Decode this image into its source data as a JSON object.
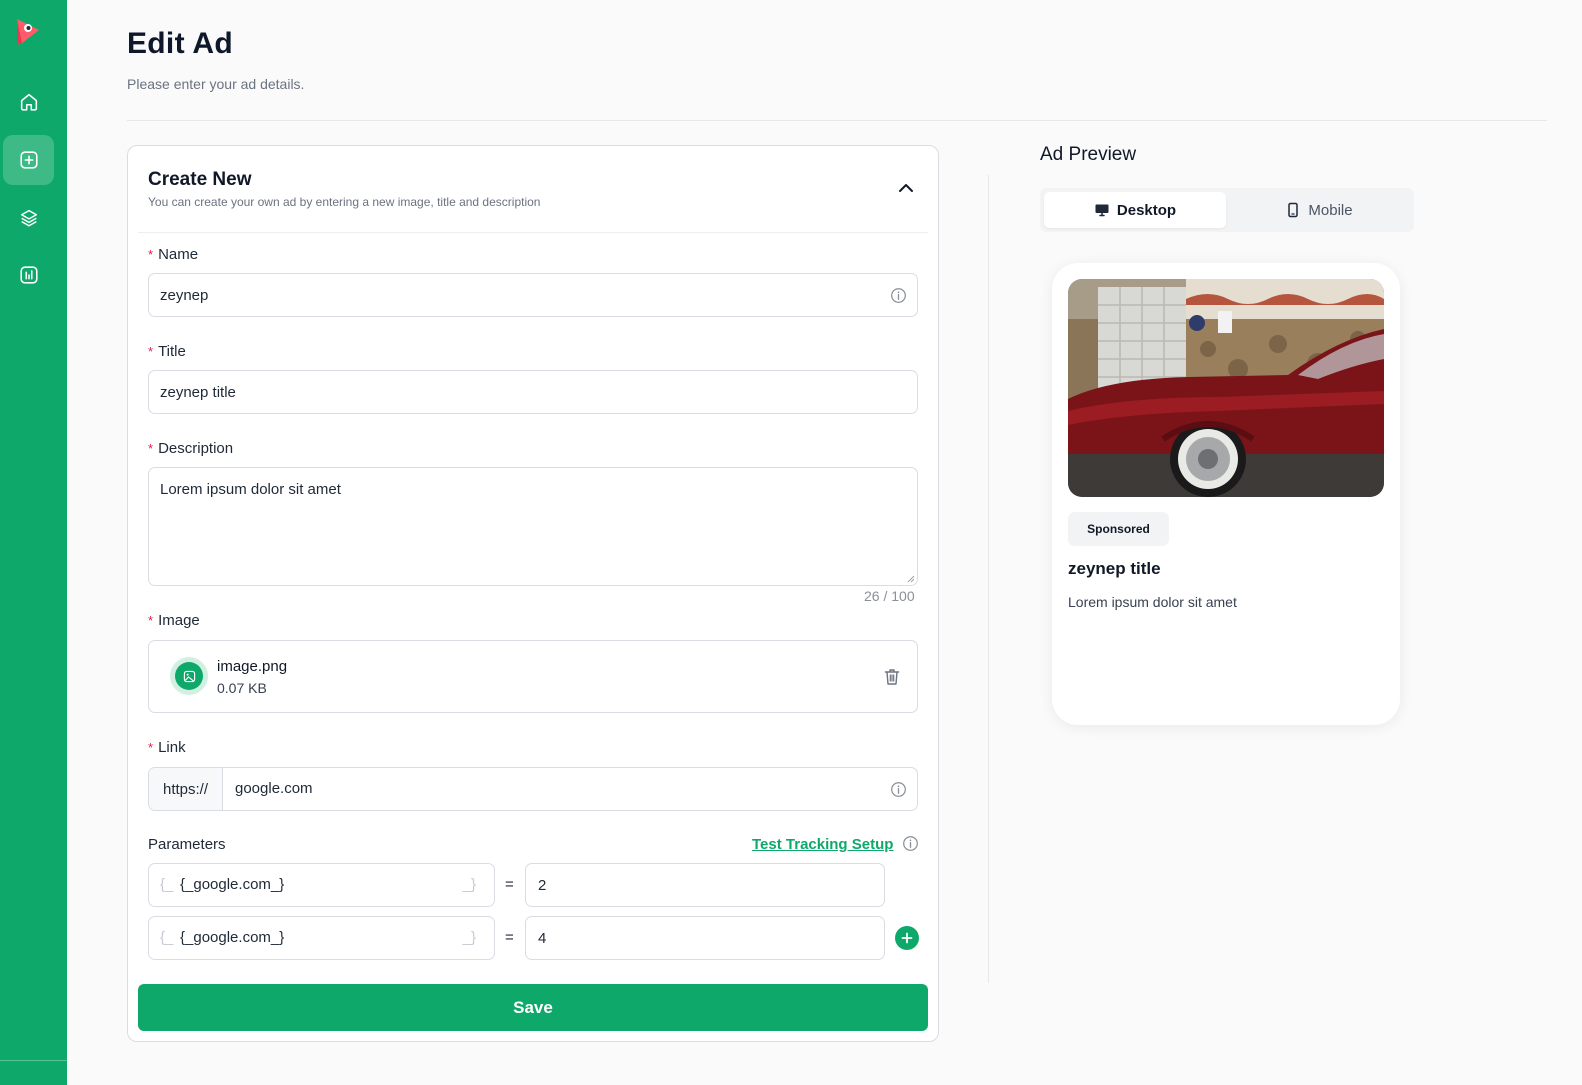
{
  "page": {
    "title": "Edit Ad",
    "subtitle": "Please enter your ad details."
  },
  "sidebar": {
    "items": [
      {
        "icon": "home-icon",
        "active": false
      },
      {
        "icon": "plus-square-icon",
        "active": true
      },
      {
        "icon": "layers-icon",
        "active": false
      },
      {
        "icon": "chart-icon",
        "active": false
      }
    ],
    "accent": "#0ea96a"
  },
  "form": {
    "title": "Create New",
    "subtitle": "You can create your own ad by entering a new image, title and description",
    "name": {
      "label": "Name",
      "value": "zeynep"
    },
    "title_field": {
      "label": "Title",
      "value": "zeynep title"
    },
    "description": {
      "label": "Description",
      "value": "Lorem ipsum dolor sit amet",
      "counter": "26 / 100"
    },
    "image": {
      "label": "Image",
      "file_name": "image.png",
      "file_size": "0.07 KB"
    },
    "link": {
      "label": "Link",
      "prefix": "https://",
      "value": "google.com"
    },
    "parameters": {
      "label": "Parameters",
      "tracking_link": "Test Tracking Setup",
      "brace_left": "{_",
      "brace_right": "_}",
      "equals": "=",
      "rows": [
        {
          "key": "{_google.com_}",
          "value": "2"
        },
        {
          "key": "{_google.com_}",
          "value": "4"
        }
      ]
    },
    "save_label": "Save"
  },
  "preview": {
    "title": "Ad Preview",
    "tabs": [
      {
        "label": "Desktop",
        "icon": "monitor-icon",
        "active": true
      },
      {
        "label": "Mobile",
        "icon": "smartphone-icon",
        "active": false
      }
    ],
    "sponsored": "Sponsored",
    "ad_title": "zeynep title",
    "ad_description": "Lorem ipsum dolor sit amet"
  }
}
